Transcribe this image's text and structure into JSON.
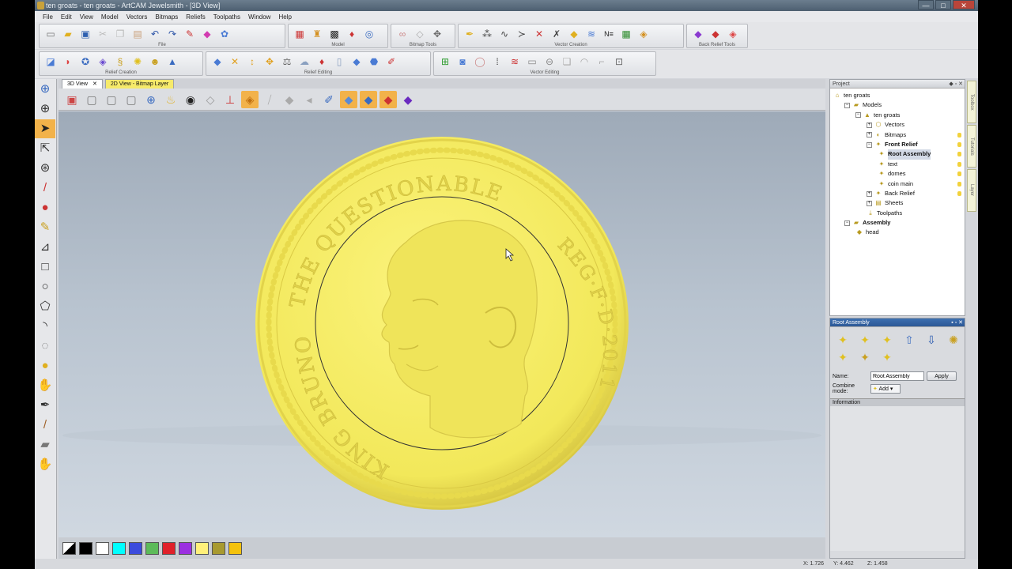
{
  "window": {
    "title": "ten groats - ten groats - ArtCAM Jewelsmith - [3D View]",
    "min": "—",
    "max": "□",
    "close": "✕"
  },
  "menu": [
    "File",
    "Edit",
    "View",
    "Model",
    "Vectors",
    "Bitmaps",
    "Reliefs",
    "Toolpaths",
    "Window",
    "Help"
  ],
  "toolbar_groups": {
    "file": "File",
    "model": "Model",
    "bitmap_tools": "Bitmap Tools",
    "vector_creation": "Vector Creation",
    "back_relief_tools": "Back Relief Tools",
    "relief_creation": "Relief Creation",
    "relief_editing": "Relief Editing",
    "vector_editing": "Vector Editing"
  },
  "tabs": [
    {
      "label": "3D View",
      "close": "✕"
    },
    {
      "label": "2D View - Bitmap Layer"
    }
  ],
  "coin": {
    "top_legend": "THE QUESTIONABLE",
    "left_legend": "KING BRUNO",
    "right_legend": "REG·F·D·2011",
    "color": "#f2e85a"
  },
  "palette": [
    "#ffffff",
    "#000000",
    "#ffffff",
    "#00ffff",
    "#3b4bdc",
    "#5dbb5a",
    "#e0202a",
    "#9b30e0",
    "#fff07a",
    "#a89a30",
    "#f4c20d"
  ],
  "project": {
    "header": "Project",
    "tree": [
      {
        "label": "ten groats",
        "level": 0,
        "icon": "⌂"
      },
      {
        "label": "Models",
        "level": 1,
        "icon": "▰",
        "exp": "−"
      },
      {
        "label": "ten groats",
        "level": 2,
        "icon": "▲",
        "exp": "−"
      },
      {
        "label": "Vectors",
        "level": 3,
        "icon": "⬡",
        "exp": "+"
      },
      {
        "label": "Bitmaps",
        "level": 3,
        "icon": "◐",
        "exp": "+",
        "lamp": true
      },
      {
        "label": "Front Relief",
        "level": 3,
        "icon": "✦",
        "exp": "−",
        "bold": true,
        "lamp": true
      },
      {
        "label": "Root Assembly",
        "level": 4,
        "icon": "✦",
        "sel": true,
        "bold": true,
        "lamp": true
      },
      {
        "label": "text",
        "level": 4,
        "icon": "✦",
        "lamp": true
      },
      {
        "label": "domes",
        "level": 4,
        "icon": "✦",
        "lamp": true
      },
      {
        "label": "coin main",
        "level": 4,
        "icon": "✦",
        "lamp": true
      },
      {
        "label": "Back Relief",
        "level": 3,
        "icon": "✦",
        "exp": "+",
        "lamp": true
      },
      {
        "label": "Sheets",
        "level": 3,
        "icon": "▤",
        "exp": "+"
      },
      {
        "label": "Toolpaths",
        "level": 3,
        "icon": "⤓"
      },
      {
        "label": "Assembly",
        "level": 1,
        "icon": "▰",
        "exp": "−",
        "bold": true
      },
      {
        "label": "head",
        "level": 2,
        "icon": "◆"
      }
    ]
  },
  "side_tabs": [
    "Toolbox",
    "Tutorials",
    "Layer"
  ],
  "root_assembly": {
    "header": "Root Assembly",
    "name_label": "Name:",
    "name_value": "Root Assembly",
    "apply": "Apply",
    "combine_label": "Combine mode:",
    "combine_value": "Add",
    "info_header": "Information"
  },
  "status": {
    "x": "X: 1.726",
    "y": "Y: 4.462",
    "z": "Z: 1.458"
  }
}
